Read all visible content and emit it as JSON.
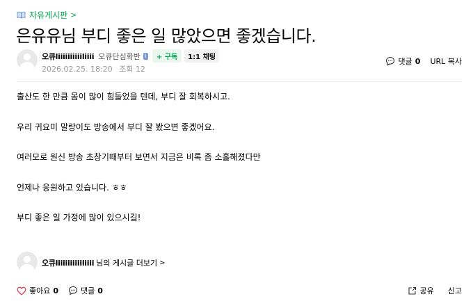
{
  "board": {
    "name": "자유게시판",
    "chevron": ">",
    "icon": "book-icon"
  },
  "post": {
    "title": "은유유님 부디 좋은 일 많았으면 좋겠습니다.",
    "author": {
      "nickname": "오큐liiiiiiiiiiliiii",
      "grade": "오큐단심화반",
      "grade_icon": "i",
      "subscribe_label": "+ 구독",
      "chat_label": "1:1 채팅"
    },
    "date": "2026.02.25. 18:20",
    "views_label": "조회 12",
    "comment_label": "댓글",
    "comment_count": "0",
    "url_copy_label": "URL 복사",
    "body": [
      "출산도 한 만큼 몸이 많이 힘들었을 텐데, 부디 잘 회복하시고.",
      "우리 귀요미 말랑이도 방송에서 부디 잘 봤으면 좋겠어요.",
      "여러모로 원신 방송 초창기때부터 보면서 지금은 비록 좀 소홀해졌다만",
      "언제나 응원하고 있습니다. ㅎㅎ",
      "부디 좋은 일 가정에 많이 있으시길!"
    ]
  },
  "more_posts": {
    "nickname": "오큐liiiiiiiiiiliiii",
    "text": "님의 게시글 더보기",
    "chevron": ">"
  },
  "bottom": {
    "like_label": "좋아요",
    "like_count": "0",
    "comment_label": "댓글",
    "comment_count": "0",
    "share_label": "공유",
    "report_label": "신고"
  },
  "colors": {
    "accent": "#03a94e",
    "like": "#e8405f",
    "meta": "#979797"
  }
}
